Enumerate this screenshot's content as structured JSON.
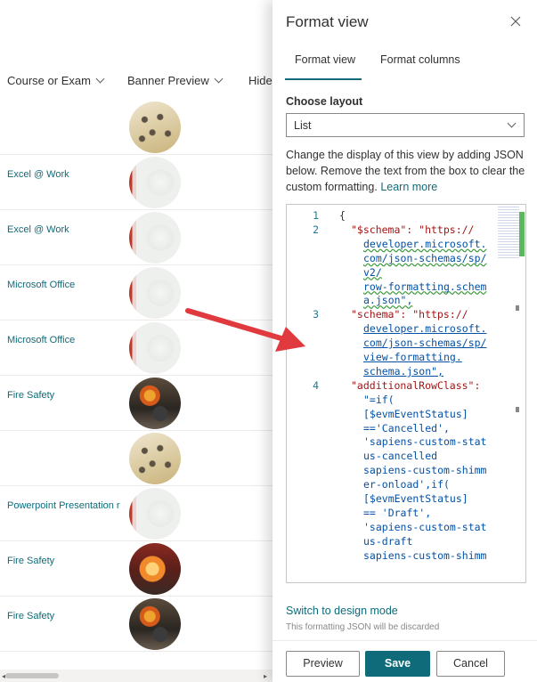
{
  "list": {
    "columns": [
      "Course or Exam",
      "Banner Preview",
      "Hide"
    ],
    "rows": [
      {
        "course": "",
        "image": "chairs"
      },
      {
        "course": "Excel @ Work",
        "image": "excel"
      },
      {
        "course": "Excel @ Work",
        "image": "excel"
      },
      {
        "course": "Microsoft Office",
        "image": "excel"
      },
      {
        "course": "Microsoft Office",
        "image": "excel"
      },
      {
        "course": "Fire Safety",
        "image": "fire"
      },
      {
        "course": "",
        "image": "chairs"
      },
      {
        "course": "Powerpoint Presentation r",
        "image": "excel"
      },
      {
        "course": "Fire Safety",
        "image": "fire2"
      },
      {
        "course": "Fire Safety",
        "image": "fire"
      }
    ]
  },
  "panel": {
    "title": "Format view",
    "close_icon": "close-icon",
    "tabs": [
      "Format view",
      "Format columns"
    ],
    "active_tab": "Format view",
    "choose_layout_label": "Choose layout",
    "layout_value": "List",
    "description": "Change the display of this view by adding JSON below. Remove the text from the box to clear the custom formatting.",
    "learn_more": "Learn more",
    "editor": {
      "line_numbers": [
        "1",
        "2",
        "3",
        "4"
      ],
      "lines": [
        {
          "text": "{",
          "kind": "punc"
        },
        {
          "text": "\"$schema\": \"https://",
          "kind": "key"
        },
        {
          "text": "developer.microsoft.",
          "kind": "str"
        },
        {
          "text": "com/json-schemas/sp/",
          "kind": "str"
        },
        {
          "text": "v2/",
          "kind": "str"
        },
        {
          "text": "row-formatting.schem",
          "kind": "str"
        },
        {
          "text": "a.json\",",
          "kind": "str"
        },
        {
          "text": "\"schema\": \"https://",
          "kind": "key"
        },
        {
          "text": "developer.microsoft.",
          "kind": "str"
        },
        {
          "text": "com/json-schemas/sp/",
          "kind": "str"
        },
        {
          "text": "view-formatting.",
          "kind": "str"
        },
        {
          "text": "schema.json\",",
          "kind": "str"
        },
        {
          "text": "\"additionalRowClass\":",
          "kind": "key"
        },
        {
          "text": "\"=if(",
          "kind": "val"
        },
        {
          "text": "[$evmEventStatus]",
          "kind": "val"
        },
        {
          "text": "=='Cancelled',",
          "kind": "val"
        },
        {
          "text": "'sapiens-custom-stat",
          "kind": "val"
        },
        {
          "text": "us-cancelled",
          "kind": "val"
        },
        {
          "text": "sapiens-custom-shimm",
          "kind": "val"
        },
        {
          "text": "er-onload',if(",
          "kind": "val"
        },
        {
          "text": "[$evmEventStatus]",
          "kind": "val"
        },
        {
          "text": "== 'Draft',",
          "kind": "val"
        },
        {
          "text": "'sapiens-custom-stat",
          "kind": "val"
        },
        {
          "text": "us-draft",
          "kind": "val"
        },
        {
          "text": "sapiens-custom-shimm",
          "kind": "val"
        }
      ]
    },
    "switch_link": "Switch to design mode",
    "switch_note": "This formatting JSON will be discarded",
    "buttons": {
      "preview": "Preview",
      "save": "Save",
      "cancel": "Cancel"
    }
  },
  "colors": {
    "accent": "#0f6b7a",
    "arrow": "#e0393e",
    "scroll_ok": "#5cb85c"
  }
}
